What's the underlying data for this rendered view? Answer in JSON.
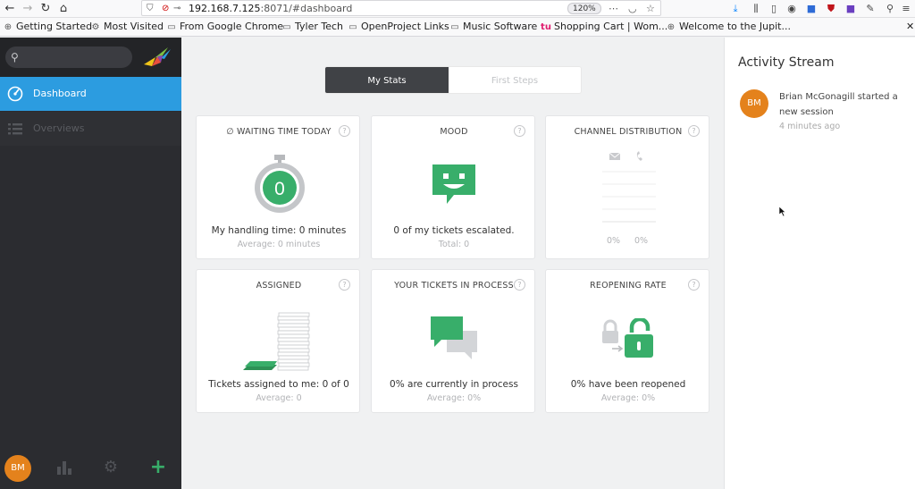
{
  "browser": {
    "url_host": "192.168.7.125",
    "url_rest": ":8071/#dashboard",
    "zoom": "120%"
  },
  "bookmarks": [
    {
      "label": "Getting Started",
      "icon": "globe-icon"
    },
    {
      "label": "Most Visited",
      "icon": "gear-icon"
    },
    {
      "label": "From Google Chrome",
      "icon": "folder-icon"
    },
    {
      "label": "Tyler Tech",
      "icon": "folder-icon"
    },
    {
      "label": "OpenProject Links",
      "icon": "folder-icon"
    },
    {
      "label": "Music Software",
      "icon": "folder-icon"
    },
    {
      "label": "Shopping Cart | Wom...",
      "icon": "tu-icon"
    },
    {
      "label": "Welcome to the Jupit...",
      "icon": "globe-icon"
    }
  ],
  "sidebar": {
    "search_placeholder": "",
    "nav": [
      {
        "label": "Dashboard",
        "icon": "dashboard-icon",
        "active": true
      },
      {
        "label": "Overviews",
        "icon": "list-icon",
        "active": false
      }
    ],
    "user_initials": "BM"
  },
  "tabs": [
    {
      "label": "My Stats",
      "selected": true
    },
    {
      "label": "First Steps",
      "selected": false
    }
  ],
  "cards": [
    {
      "title": "∅ WAITING TIME TODAY",
      "value": "My handling time: 0 minutes",
      "sub": "Average: 0 minutes",
      "art": "stopwatch-icon",
      "number": "0"
    },
    {
      "title": "MOOD",
      "value": "0 of my tickets escalated.",
      "sub": "Total: 0",
      "art": "smiley-chat-icon"
    },
    {
      "title": "CHANNEL DISTRIBUTION",
      "value": "",
      "sub": "",
      "art": "channel-chart",
      "percent_email": "0%",
      "percent_phone": "0%"
    },
    {
      "title": "ASSIGNED",
      "value": "Tickets assigned to me: 0 of 0",
      "sub": "Average: 0",
      "art": "paper-stack-icon"
    },
    {
      "title": "YOUR TICKETS IN PROCESS",
      "value": "0% are currently in process",
      "sub": "Average: 0%",
      "art": "chat-bubbles-icon"
    },
    {
      "title": "REOPENING RATE",
      "value": "0% have been reopened",
      "sub": "Average: 0%",
      "art": "lock-open-icon"
    }
  ],
  "colors": {
    "accent": "#2c9ce0",
    "green": "#38ae6a",
    "avatar": "#e4821c",
    "sidebar": "#2b2c30"
  },
  "activity": {
    "title": "Activity Stream",
    "items": [
      {
        "initials": "BM",
        "text": "Brian McGonagill started a new session",
        "time": "4 minutes ago"
      }
    ]
  }
}
